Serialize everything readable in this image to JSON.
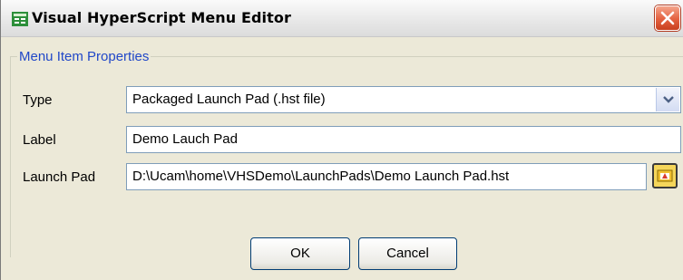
{
  "window": {
    "title": "Visual HyperScript Menu Editor",
    "icon": "app-icon",
    "close_icon": "close-icon"
  },
  "group": {
    "legend": "Menu Item Properties",
    "legend_color": "#2148c8"
  },
  "fields": {
    "type": {
      "label": "Type",
      "value": "Packaged Launch Pad (.hst file)"
    },
    "label": {
      "label": "Label",
      "value": "Demo Lauch Pad"
    },
    "launch_pad": {
      "label": "Launch Pad",
      "value": "D:\\Ucam\\home\\VHSDemo\\LaunchPads\\Demo Launch Pad.hst",
      "browse_icon": "browse-folder-icon"
    }
  },
  "buttons": {
    "ok": "OK",
    "cancel": "Cancel"
  }
}
